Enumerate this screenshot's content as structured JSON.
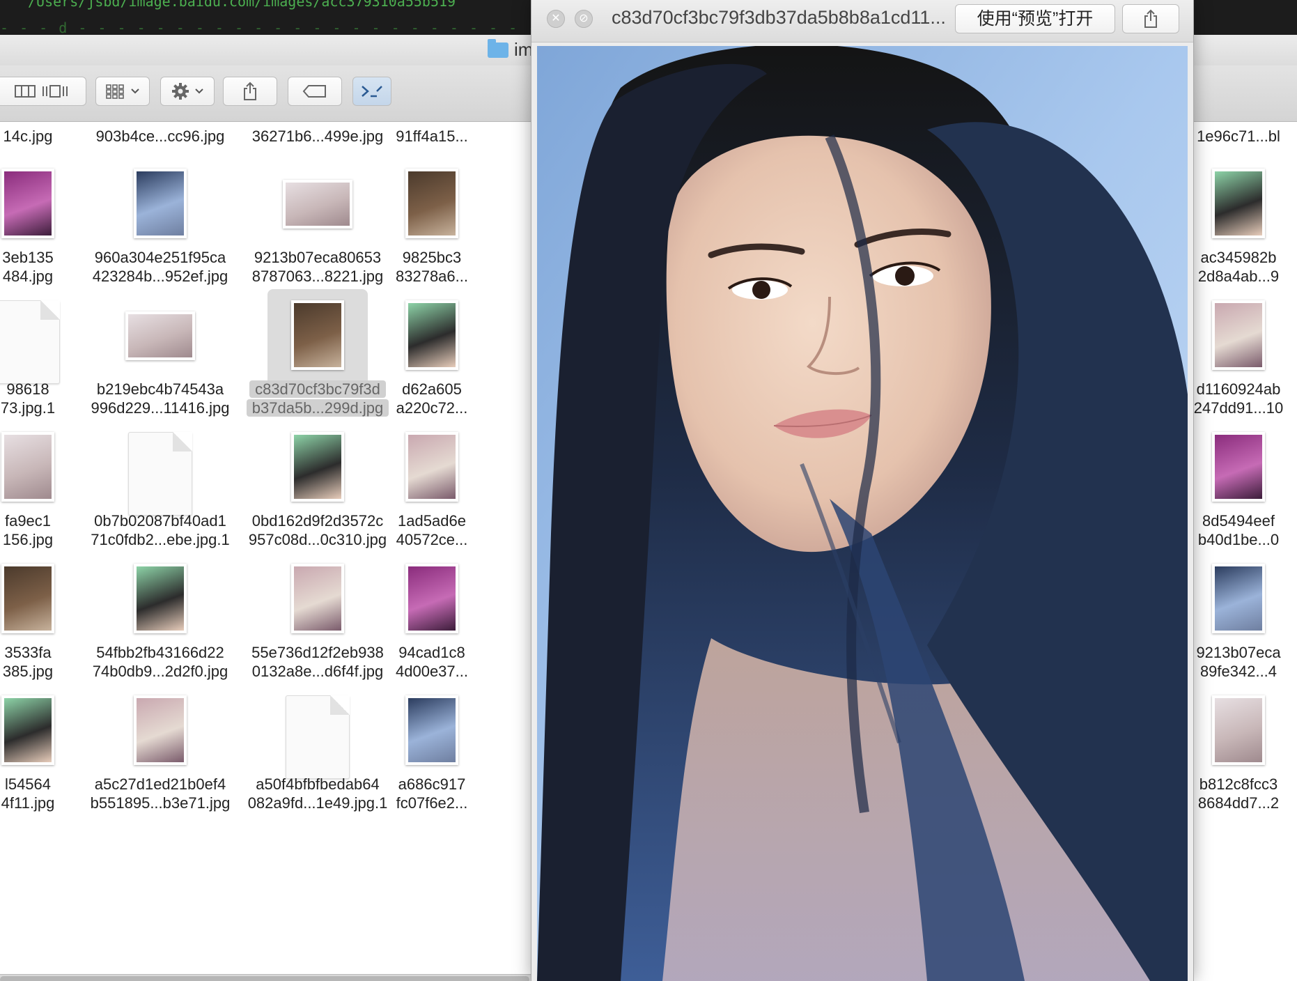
{
  "terminal": {
    "line1": "/Users/jsbd/image.baidu.com/images/acc379310a55b519",
    "line2": "- - - d - - - - - - - - - - - - - - - - - - - - - - - - - - - - - - - - - - - - - - - - -"
  },
  "finder": {
    "title": "im",
    "toolbar": {
      "view_columns": "columns-view-icon",
      "view_coverflow": "coverflow-view-icon",
      "arrange": "arrange-grid-icon",
      "action": "gear-icon",
      "share": "share-icon",
      "tags": "tag-icon",
      "terminal": "terminal-icon"
    },
    "columns": [
      {
        "items": [
          {
            "name": "14c.jpg",
            "thumb": "none"
          },
          {
            "name": "3eb135\n484.jpg",
            "thumb": "image"
          },
          {
            "name": "98618\n73.jpg.1",
            "thumb": "doc"
          },
          {
            "name": "fa9ec1\n156.jpg",
            "thumb": "image"
          },
          {
            "name": "3533fa\n385.jpg",
            "thumb": "image"
          },
          {
            "name": "l54564\n4f11.jpg",
            "thumb": "image"
          }
        ]
      },
      {
        "items": [
          {
            "name": "903b4ce...cc96.jpg",
            "thumb": "none"
          },
          {
            "name": "960a304e251f95ca\n423284b...952ef.jpg",
            "thumb": "image"
          },
          {
            "name": "b219ebc4b74543a\n996d229...11416.jpg",
            "thumb": "image"
          },
          {
            "name": "0b7b02087bf40ad1\n71c0fdb2...ebe.jpg.1",
            "thumb": "doc"
          },
          {
            "name": "54fbb2fb43166d22\n74b0db9...2d2f0.jpg",
            "thumb": "image"
          },
          {
            "name": "a5c27d1ed21b0ef4\nb551895...b3e71.jpg",
            "thumb": "image"
          }
        ]
      },
      {
        "items": [
          {
            "name": "36271b6...499e.jpg",
            "thumb": "none"
          },
          {
            "name": "9213b07eca80653\n8787063...8221.jpg",
            "thumb": "image"
          },
          {
            "name": "c83d70cf3bc79f3d\nb37da5b...299d.jpg",
            "thumb": "image",
            "selected": true
          },
          {
            "name": "0bd162d9f2d3572c\n957c08d...0c310.jpg",
            "thumb": "image"
          },
          {
            "name": "55e736d12f2eb938\n0132a8e...d6f4f.jpg",
            "thumb": "image"
          },
          {
            "name": "a50f4bfbfbedab64\n082a9fd...1e49.jpg.1",
            "thumb": "doc"
          }
        ]
      },
      {
        "items": [
          {
            "name": "91ff4a15...",
            "thumb": "none"
          },
          {
            "name": "9825bc3\n83278a6...",
            "thumb": "image"
          },
          {
            "name": "d62a605\na220c72...",
            "thumb": "image"
          },
          {
            "name": "1ad5ad6e\n40572ce...",
            "thumb": "image"
          },
          {
            "name": "94cad1c8\n4d00e37...",
            "thumb": "image"
          },
          {
            "name": "a686c917\nfc07f6e2...",
            "thumb": "image"
          }
        ]
      },
      {
        "items": [
          {
            "name": "1e96c71...bl",
            "thumb": "none"
          },
          {
            "name": "ac345982b\n2d8a4ab...9",
            "thumb": "image"
          },
          {
            "name": "d1160924ab\n247dd91...10",
            "thumb": "image"
          },
          {
            "name": "8d5494eef\nb40d1be...0",
            "thumb": "image"
          },
          {
            "name": "9213b07eca\n89fe342...4",
            "thumb": "image"
          },
          {
            "name": "b812c8fcc3\n8684dd7...2",
            "thumb": "image"
          }
        ]
      }
    ]
  },
  "quicklook": {
    "title": "c83d70cf3bc79f3db37da5b8b8a1cd11...",
    "open_button": "使用“预览”打开",
    "close_icon": "close-icon",
    "fullscreen_icon": "fullscreen-icon",
    "share_icon": "share-icon",
    "photo_alt": "portrait-photo"
  },
  "colors": {
    "accent": "#1f4f8a",
    "sky": "#a8c8ee",
    "hair": "#1d2d4a",
    "skin": "#e9c9b4"
  }
}
